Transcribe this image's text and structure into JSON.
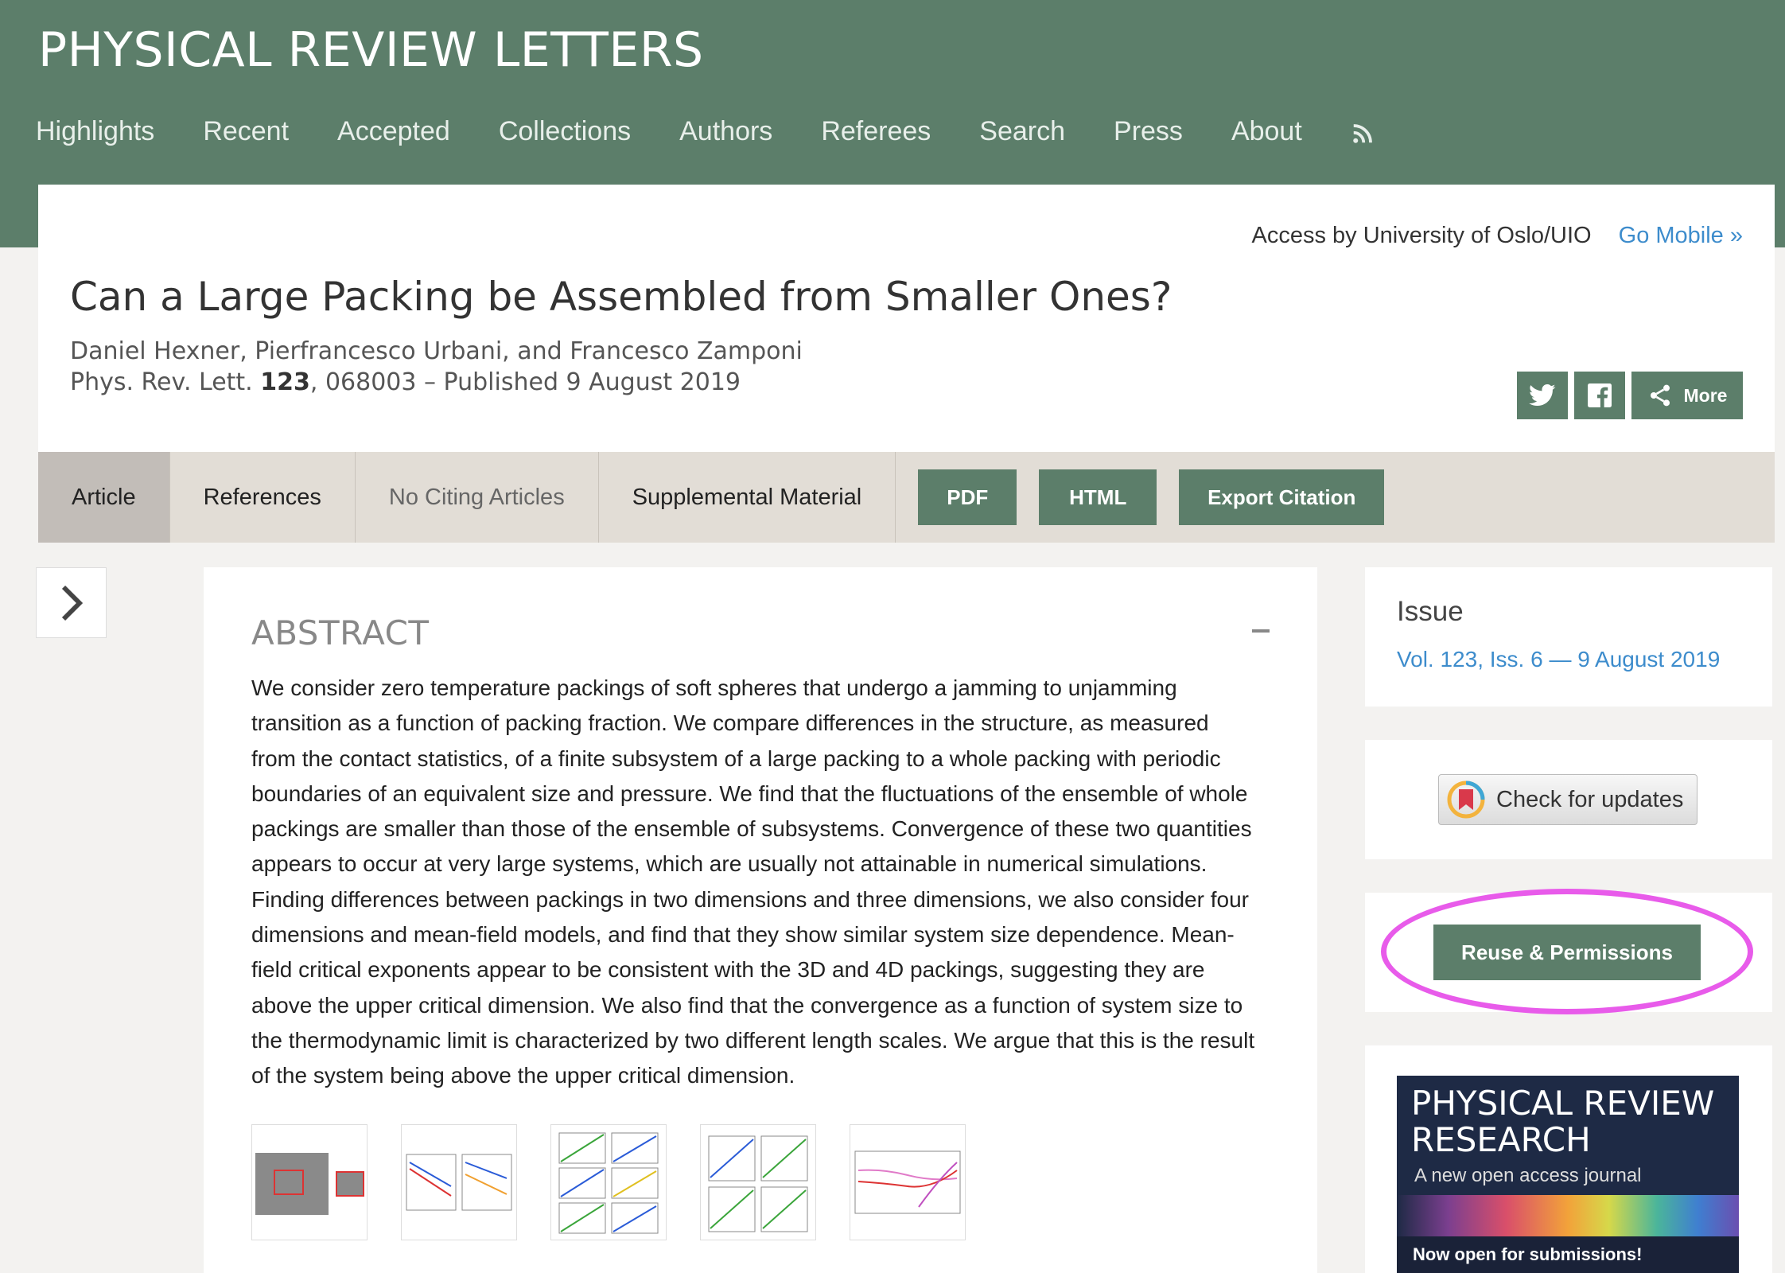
{
  "site": {
    "title": "PHYSICAL REVIEW LETTERS"
  },
  "nav": {
    "items": [
      "Highlights",
      "Recent",
      "Accepted",
      "Collections",
      "Authors",
      "Referees",
      "Search",
      "Press",
      "About"
    ],
    "rss_icon": "rss-icon"
  },
  "access": {
    "text": "Access by University of Oslo/UIO",
    "go_mobile": "Go Mobile »"
  },
  "article": {
    "title": "Can a Large Packing be Assembled from Smaller Ones?",
    "authors": "Daniel Hexner, Pierfrancesco Urbani, and Francesco Zamponi",
    "journal": "Phys. Rev. Lett.",
    "volume": "123",
    "citation_rest": ", 068003 – Published 9 August 2019"
  },
  "share": {
    "twitter_icon": "twitter-icon",
    "facebook_icon": "facebook-icon",
    "more_label": "More"
  },
  "tabs": [
    "Article",
    "References",
    "No Citing Articles",
    "Supplemental Material"
  ],
  "actions": {
    "pdf": "PDF",
    "html": "HTML",
    "export": "Export Citation"
  },
  "abstract": {
    "heading": "ABSTRACT",
    "lines": [
      "We consider zero temperature packings of soft spheres that undergo a jamming to unjamming",
      "transition as a function of packing fraction. We compare differences in the structure, as measured",
      "from the contact statistics, of a finite subsystem of a large packing to a whole packing with periodic",
      "boundaries of an equivalent size and pressure. We find that the fluctuations of the ensemble of whole",
      "packings are smaller than those of the ensemble of subsystems. Convergence of these two quantities",
      "appears to occur at very large systems, which are usually not attainable in numerical simulations.",
      "Finding differences between packings in two dimensions and three dimensions, we also consider four",
      "dimensions and mean-field models, and find that they show similar system size dependence. Mean-",
      "field critical exponents appear to be consistent with the 3D and 4D packings, suggesting they are",
      "above the upper critical dimension. We also find that the convergence as a function of system size to",
      "the thermodynamic limit is characterized by two different length scales. We argue that this is the result",
      "of the system being above the upper critical dimension."
    ]
  },
  "sidebar": {
    "issue_label": "Issue",
    "issue_link": "Vol. 123, Iss. 6 — 9 August 2019",
    "check_updates": "Check for updates",
    "reuse": "Reuse & Permissions",
    "ad": {
      "title_line1": "PHYSICAL REVIEW",
      "title_line2": "RESEARCH",
      "subtitle": "A new open access journal",
      "cta": "Now open for submissions!"
    }
  },
  "colors": {
    "brand_green": "#5c7e6a",
    "link_blue": "#3d8ccc",
    "highlight_magenta": "#e85bea"
  }
}
